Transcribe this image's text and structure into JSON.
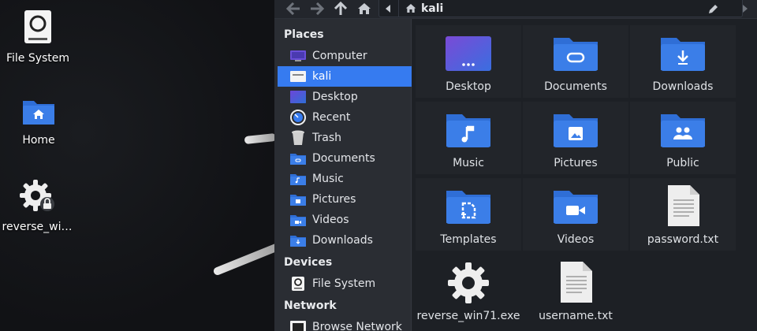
{
  "colors": {
    "accent": "#367bf0",
    "folder": "#3b7ee8",
    "folder_tab": "#2f6ed6",
    "sidebar_bg": "#2a2d33"
  },
  "desktop": {
    "icons": [
      {
        "label": "File System",
        "icon": "drive-icon"
      },
      {
        "label": "Home",
        "icon": "home-folder-icon"
      },
      {
        "label": "reverse_wi…",
        "icon": "gear-locked-icon"
      }
    ]
  },
  "toolbar": {
    "buttons": [
      "back-arrow-icon",
      "forward-arrow-icon",
      "up-arrow-icon",
      "home-icon",
      "chevron-left-icon",
      "pencil-icon",
      "chevron-right-icon"
    ],
    "path_label": "kali"
  },
  "sidebar": {
    "places_heading": "Places",
    "places": [
      {
        "label": "Computer",
        "icon": "monitor-icon"
      },
      {
        "label": "kali",
        "icon": "home-drive-icon",
        "selected": true
      },
      {
        "label": "Desktop",
        "icon": "desktop-icon"
      },
      {
        "label": "Recent",
        "icon": "recent-icon"
      },
      {
        "label": "Trash",
        "icon": "trash-icon"
      },
      {
        "label": "Documents",
        "icon": "documents-folder-icon"
      },
      {
        "label": "Music",
        "icon": "music-folder-icon"
      },
      {
        "label": "Pictures",
        "icon": "pictures-folder-icon"
      },
      {
        "label": "Videos",
        "icon": "videos-folder-icon"
      },
      {
        "label": "Downloads",
        "icon": "downloads-folder-icon"
      }
    ],
    "devices_heading": "Devices",
    "devices": [
      {
        "label": "File System",
        "icon": "drive-icon"
      }
    ],
    "network_heading": "Network",
    "network": [
      {
        "label": "Browse Network",
        "icon": "network-icon"
      }
    ]
  },
  "files": [
    {
      "name": "Desktop",
      "icon": "desktop-folder-icon"
    },
    {
      "name": "Documents",
      "icon": "documents-folder-icon"
    },
    {
      "name": "Downloads",
      "icon": "downloads-folder-icon"
    },
    {
      "name": "Music",
      "icon": "music-folder-icon"
    },
    {
      "name": "Pictures",
      "icon": "pictures-folder-icon"
    },
    {
      "name": "Public",
      "icon": "public-folder-icon"
    },
    {
      "name": "Templates",
      "icon": "templates-folder-icon"
    },
    {
      "name": "Videos",
      "icon": "videos-folder-icon"
    },
    {
      "name": "password.txt",
      "icon": "text-file-icon"
    },
    {
      "name": "reverse_win71.exe",
      "icon": "gear-executable-icon"
    },
    {
      "name": "username.txt",
      "icon": "text-file-icon"
    }
  ]
}
